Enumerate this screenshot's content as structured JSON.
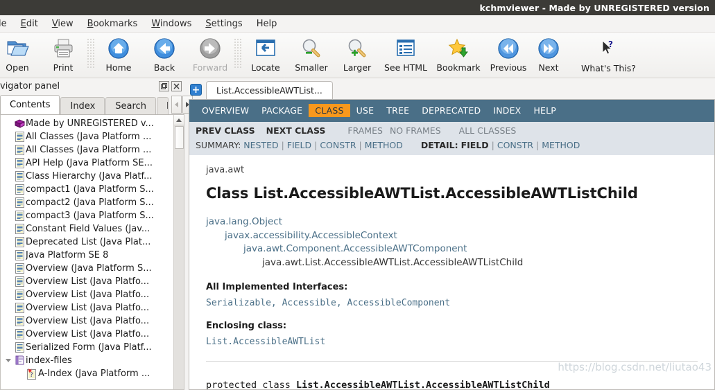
{
  "window": {
    "title": "kchmviewer - Made by UNREGISTERED version"
  },
  "menubar": {
    "items": [
      {
        "label": "le",
        "accel": "",
        "name": "menu-file"
      },
      {
        "label": "Edit",
        "accel": "E",
        "name": "menu-edit"
      },
      {
        "label": "View",
        "accel": "V",
        "name": "menu-view"
      },
      {
        "label": "Bookmarks",
        "accel": "B",
        "name": "menu-bookmarks"
      },
      {
        "label": "Windows",
        "accel": "W",
        "name": "menu-windows"
      },
      {
        "label": "Settings",
        "accel": "S",
        "name": "menu-settings"
      },
      {
        "label": "Help",
        "accel": "",
        "name": "menu-help"
      }
    ]
  },
  "toolbar": {
    "buttons": [
      {
        "label": "Open",
        "icon": "open-folder-icon",
        "disabled": false
      },
      {
        "label": "Print",
        "icon": "printer-icon",
        "disabled": false
      },
      {
        "label": "Home",
        "icon": "home-icon",
        "disabled": false
      },
      {
        "label": "Back",
        "icon": "back-arrow-icon",
        "disabled": false
      },
      {
        "label": "Forward",
        "icon": "forward-arrow-icon",
        "disabled": true
      },
      {
        "label": "Locate",
        "icon": "locate-panel-icon",
        "disabled": false
      },
      {
        "label": "Smaller",
        "icon": "zoom-out-icon",
        "disabled": false
      },
      {
        "label": "Larger",
        "icon": "zoom-in-icon",
        "disabled": false
      },
      {
        "label": "See HTML",
        "icon": "html-source-icon",
        "disabled": false
      },
      {
        "label": "Bookmark",
        "icon": "bookmark-star-icon",
        "disabled": false
      },
      {
        "label": "Previous",
        "icon": "previous-double-arrow-icon",
        "disabled": false
      },
      {
        "label": "Next",
        "icon": "next-double-arrow-icon",
        "disabled": false
      }
    ],
    "whats_this": "What's This?"
  },
  "navigator": {
    "panel_title": "vigator panel",
    "tabs": [
      {
        "label": "Contents",
        "active": true
      },
      {
        "label": "Index",
        "active": false
      },
      {
        "label": "Search",
        "active": false
      },
      {
        "label": "Bo",
        "active": false
      }
    ],
    "tree": [
      {
        "label": "Made by UNREGISTERED v...",
        "icon": "book-icon",
        "indent": 1,
        "expander": false
      },
      {
        "label": "All Classes (Java Platform ...",
        "icon": "page-icon",
        "indent": 1,
        "expander": false
      },
      {
        "label": "All Classes (Java Platform ...",
        "icon": "page-icon",
        "indent": 1,
        "expander": false
      },
      {
        "label": "API Help (Java Platform SE...",
        "icon": "page-icon",
        "indent": 1,
        "expander": false
      },
      {
        "label": "Class Hierarchy (Java Platf...",
        "icon": "page-icon",
        "indent": 1,
        "expander": false
      },
      {
        "label": "compact1 (Java Platform S...",
        "icon": "page-icon",
        "indent": 1,
        "expander": false
      },
      {
        "label": "compact2 (Java Platform S...",
        "icon": "page-icon",
        "indent": 1,
        "expander": false
      },
      {
        "label": "compact3 (Java Platform S...",
        "icon": "page-icon",
        "indent": 1,
        "expander": false
      },
      {
        "label": "Constant Field Values (Jav...",
        "icon": "page-icon",
        "indent": 1,
        "expander": false
      },
      {
        "label": "Deprecated List (Java Plat...",
        "icon": "page-icon",
        "indent": 1,
        "expander": false
      },
      {
        "label": "Java Platform SE 8",
        "icon": "page-icon",
        "indent": 1,
        "expander": false
      },
      {
        "label": "Overview (Java Platform S...",
        "icon": "page-icon",
        "indent": 1,
        "expander": false
      },
      {
        "label": "Overview List (Java Platfo...",
        "icon": "page-icon",
        "indent": 1,
        "expander": false
      },
      {
        "label": "Overview List (Java Platfo...",
        "icon": "page-icon",
        "indent": 1,
        "expander": false
      },
      {
        "label": "Overview List (Java Platfo...",
        "icon": "page-icon",
        "indent": 1,
        "expander": false
      },
      {
        "label": "Overview List (Java Platfo...",
        "icon": "page-icon",
        "indent": 1,
        "expander": false
      },
      {
        "label": "Overview List (Java Platfo...",
        "icon": "page-icon",
        "indent": 1,
        "expander": false
      },
      {
        "label": "Serialized Form (Java Platf...",
        "icon": "page-icon",
        "indent": 1,
        "expander": false
      },
      {
        "label": "index-files",
        "icon": "folder-book-icon",
        "indent": 1,
        "expander": true
      },
      {
        "label": "A-Index (Java Platform ...",
        "icon": "page-new-icon",
        "indent": 2,
        "expander": false
      }
    ]
  },
  "browser": {
    "tab_label": "List.AccessibleAWTList...",
    "add_tab_label": "+",
    "topnav": [
      {
        "label": "OVERVIEW",
        "active": false
      },
      {
        "label": "PACKAGE",
        "active": false
      },
      {
        "label": "CLASS",
        "active": true
      },
      {
        "label": "USE",
        "active": false
      },
      {
        "label": "TREE",
        "active": false
      },
      {
        "label": "DEPRECATED",
        "active": false
      },
      {
        "label": "INDEX",
        "active": false
      },
      {
        "label": "HELP",
        "active": false
      }
    ],
    "subnav": {
      "prev_class": "PREV CLASS",
      "next_class": "NEXT CLASS",
      "frames": "FRAMES",
      "no_frames": "NO FRAMES",
      "all_classes": "ALL CLASSES"
    },
    "summary": {
      "summary_label": "SUMMARY:",
      "summary_items": [
        "NESTED",
        "FIELD",
        "CONSTR",
        "METHOD"
      ],
      "detail_label": "DETAIL:",
      "detail_items": [
        "FIELD",
        "CONSTR",
        "METHOD"
      ]
    },
    "doc": {
      "package": "java.awt",
      "class_title": "Class List.AccessibleAWTList.AccessibleAWTListChild",
      "inheritance": [
        "java.lang.Object",
        "javax.accessibility.AccessibleContext",
        "java.awt.Component.AccessibleAWTComponent",
        "java.awt.List.AccessibleAWTList.AccessibleAWTListChild"
      ],
      "implemented_label": "All Implemented Interfaces:",
      "implemented_value": "Serializable, Accessible, AccessibleComponent",
      "enclosing_label": "Enclosing class:",
      "enclosing_value": "List.AccessibleAWTList",
      "signature_modifier": "protected class ",
      "signature_name": "List.AccessibleAWTList.AccessibleAWTListChild"
    },
    "watermark": "https://blog.csdn.net/liutao43"
  },
  "colors": {
    "titlebar_bg": "#3c3b37",
    "nav_bg": "#4a6f87",
    "nav_active": "#f8981d",
    "subnav_bg": "#dee3e9",
    "link": "#4a6f87"
  }
}
